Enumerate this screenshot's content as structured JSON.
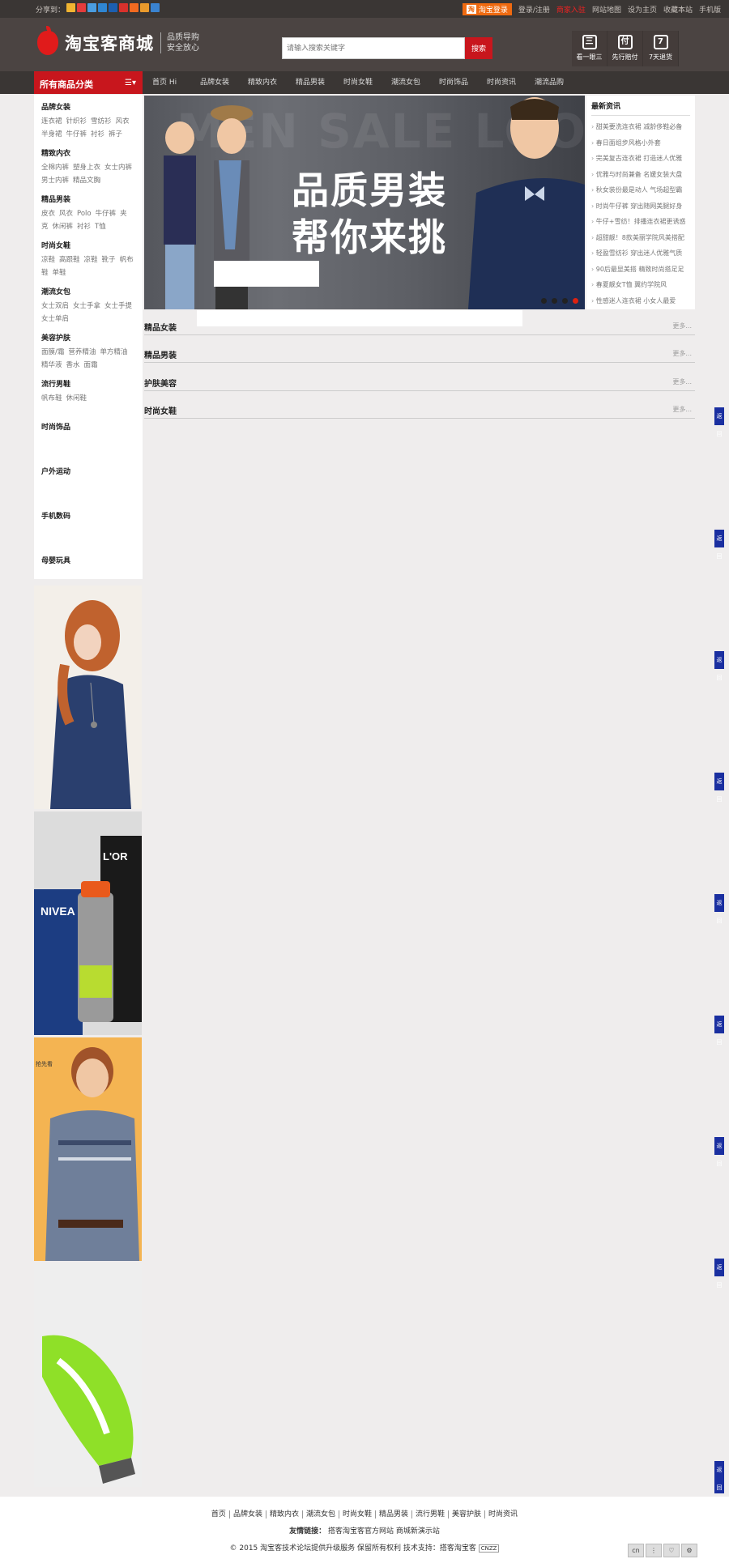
{
  "topbar": {
    "share_label": "分享到：",
    "login_badge": "淘",
    "login_label": "淘宝登录",
    "links": [
      "登录/注册",
      "商家入驻",
      "网站地图",
      "设为主页",
      "收藏本站",
      "手机版"
    ]
  },
  "header": {
    "site_name": "淘宝客商城",
    "slogan_line1": "品质导购",
    "slogan_line2": "安全放心",
    "search_placeholder": "请输入搜索关键字",
    "search_button": "搜索",
    "features": [
      {
        "icon": "三",
        "label": "看一眼三"
      },
      {
        "icon": "付",
        "label": "先行赔付"
      },
      {
        "icon": "7",
        "label": "7天退货"
      }
    ]
  },
  "nav": {
    "category_title": "所有商品分类",
    "links": [
      "首页 Hi",
      "品牌女装",
      "精致内衣",
      "精品男装",
      "时尚女鞋",
      "潮流女包",
      "时尚饰品",
      "时尚资讯",
      "潮流品购"
    ]
  },
  "categories": [
    {
      "title": "品牌女装",
      "items": [
        "连衣裙",
        "针织衫",
        "雪纺衫",
        "风衣",
        "半身裙",
        "牛仔裤",
        "衬衫",
        "裤子"
      ]
    },
    {
      "title": "精致内衣",
      "items": [
        "全棉内裤",
        "塑身上衣",
        "女士内裤",
        "男士内裤",
        "精品文胸"
      ]
    },
    {
      "title": "精品男装",
      "items": [
        "皮衣",
        "风衣",
        "Polo",
        "牛仔裤",
        "夹克",
        "休闲裤",
        "衬衫",
        "T恤"
      ]
    },
    {
      "title": "时尚女鞋",
      "items": [
        "凉鞋",
        "高跟鞋",
        "凉鞋",
        "靴子",
        "帆布鞋",
        "单鞋"
      ]
    },
    {
      "title": "潮流女包",
      "items": [
        "女士双肩",
        "女士手拿",
        "女士手提",
        "女士单肩"
      ]
    },
    {
      "title": "美容护肤",
      "items": [
        "面膜/霜",
        "营养精油",
        "单方精油",
        "精华液",
        "香水",
        "面霜"
      ]
    },
    {
      "title": "流行男鞋",
      "items": [
        "帆布鞋",
        "休闲鞋"
      ]
    }
  ],
  "single_categories": [
    "时尚饰品",
    "户外运动",
    "手机数码",
    "母婴玩具"
  ],
  "banner": {
    "bg_text": "MEN SALE LOOK",
    "line1": "品质男装",
    "line2": "帮你来挑"
  },
  "news": {
    "title": "最新资讯",
    "items": [
      "甜美要洗连衣裙 减龄侈鞋必备",
      "春日面组步风格小外套",
      "完美复古连衣裙 打造迷人优雅",
      "优雅与时尚兼备 名媛女装大盘",
      "秋女装份最是动人 气场超型霸",
      "时尚牛仔裤 穿出随网美腿好身",
      "牛仔+雪纺！排播连衣裙更诱惑",
      "超甜靓！8款美丽学院风美搭配",
      "轻盈雪纺衫 穿出迷人优雅气质",
      "90后最显美搭 精致时尚搭足足",
      "春夏靓女T恤 翼约学院风",
      "性感迷人连衣裙 小女人最爱"
    ]
  },
  "floors": [
    {
      "title": "精品女装",
      "more": "更多..."
    },
    {
      "title": "精品男装",
      "more": "更多..."
    },
    {
      "title": "护肤美容",
      "more": "更多..."
    },
    {
      "title": "时尚女鞋",
      "more": "更多..."
    }
  ],
  "side_tab_label": "返回",
  "ad_label": "抢先看",
  "footer": {
    "links": [
      "首页",
      "品牌女装",
      "精致内衣",
      "潮流女包",
      "时尚女鞋",
      "精品男装",
      "流行男鞋",
      "美容护肤",
      "时尚资讯"
    ],
    "friend_label": "友情链接：",
    "friend_links": [
      "搭客淘宝客官方网站",
      "商城新演示站"
    ],
    "copyright": "© 2015 淘宝客技术论坛提供升级服务 保留所有权利 技术支持：搭客淘宝客",
    "cnzz": "CNZZ",
    "toolbar": [
      "cn",
      "⋮",
      "♡",
      "⚙"
    ]
  },
  "colors": {
    "accent_red": "#c8161d",
    "topbar_bg": "#3a3634",
    "header_bg": "#4b4442",
    "page_bg": "#efeded",
    "login_orange": "#ef6a10",
    "sidetab_blue": "#1a2fa0"
  }
}
